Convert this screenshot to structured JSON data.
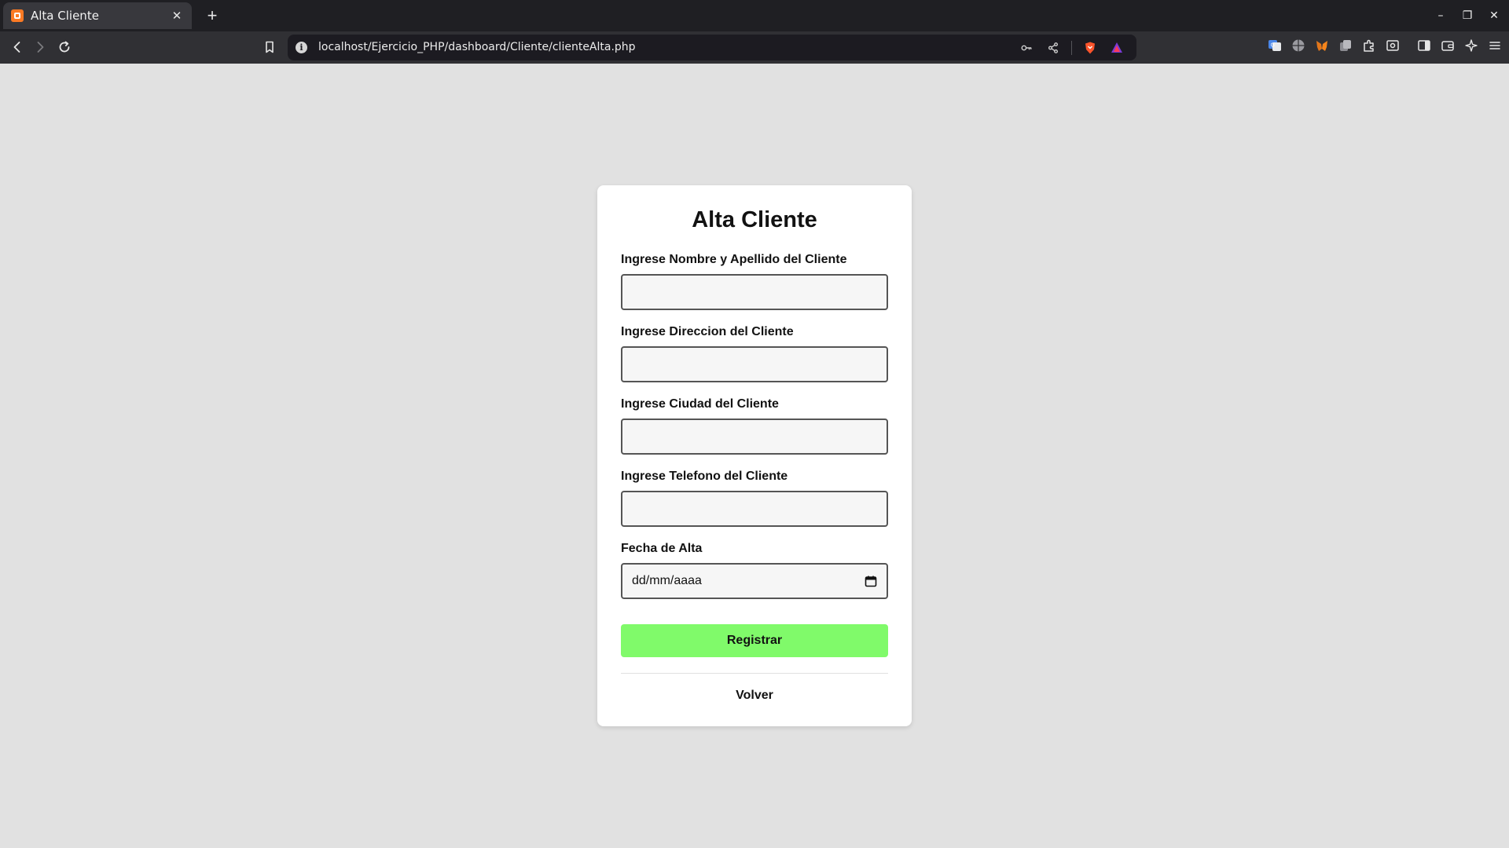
{
  "browser": {
    "tab": {
      "title": "Alta Cliente",
      "close": "✕"
    },
    "new_tab": "+",
    "window_controls": {
      "minimize": "–",
      "maximize": "❐",
      "close": "✕"
    },
    "url": "localhost/Ejercicio_PHP/dashboard/Cliente/clienteAlta.php",
    "info_icon": "i"
  },
  "form": {
    "title": "Alta Cliente",
    "fields": [
      {
        "label": "Ingrese Nombre y Apellido del Cliente",
        "value": ""
      },
      {
        "label": "Ingrese Direccion del Cliente",
        "value": ""
      },
      {
        "label": "Ingrese Ciudad del Cliente",
        "value": ""
      },
      {
        "label": "Ingrese Telefono del Cliente",
        "value": ""
      }
    ],
    "date_field": {
      "label": "Fecha de Alta",
      "placeholder": "dd/mm/aaaa"
    },
    "submit_label": "Registrar",
    "back_label": "Volver"
  },
  "colors": {
    "page_background": "#e1e1e1",
    "submit_button": "#80fa6a",
    "chrome_dark": "#1f1f23"
  }
}
